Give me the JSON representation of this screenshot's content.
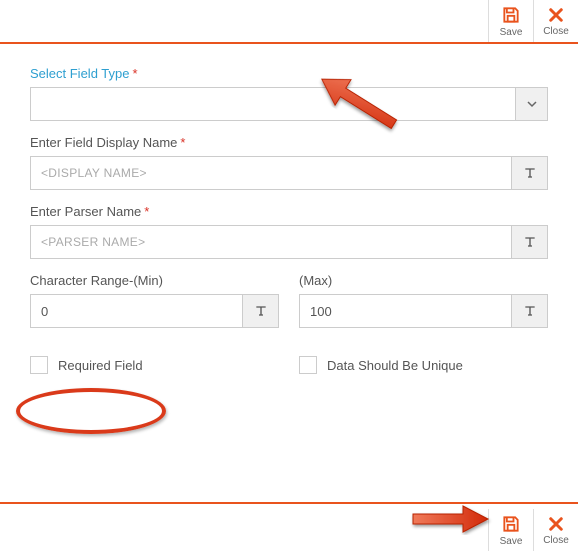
{
  "toolbar": {
    "save_label": "Save",
    "close_label": "Close"
  },
  "fields": {
    "type_label": "Select Field Type",
    "display_name_label": "Enter Field Display Name",
    "display_name_placeholder": "<Display Name>",
    "parser_name_label": "Enter Parser Name",
    "parser_name_placeholder": "<Parser Name>",
    "char_min_label": "Character Range-(Min)",
    "char_min_value": "0",
    "char_max_label": "(Max)",
    "char_max_value": "100",
    "required_label": "Required Field",
    "unique_label": "Data Should Be Unique"
  }
}
